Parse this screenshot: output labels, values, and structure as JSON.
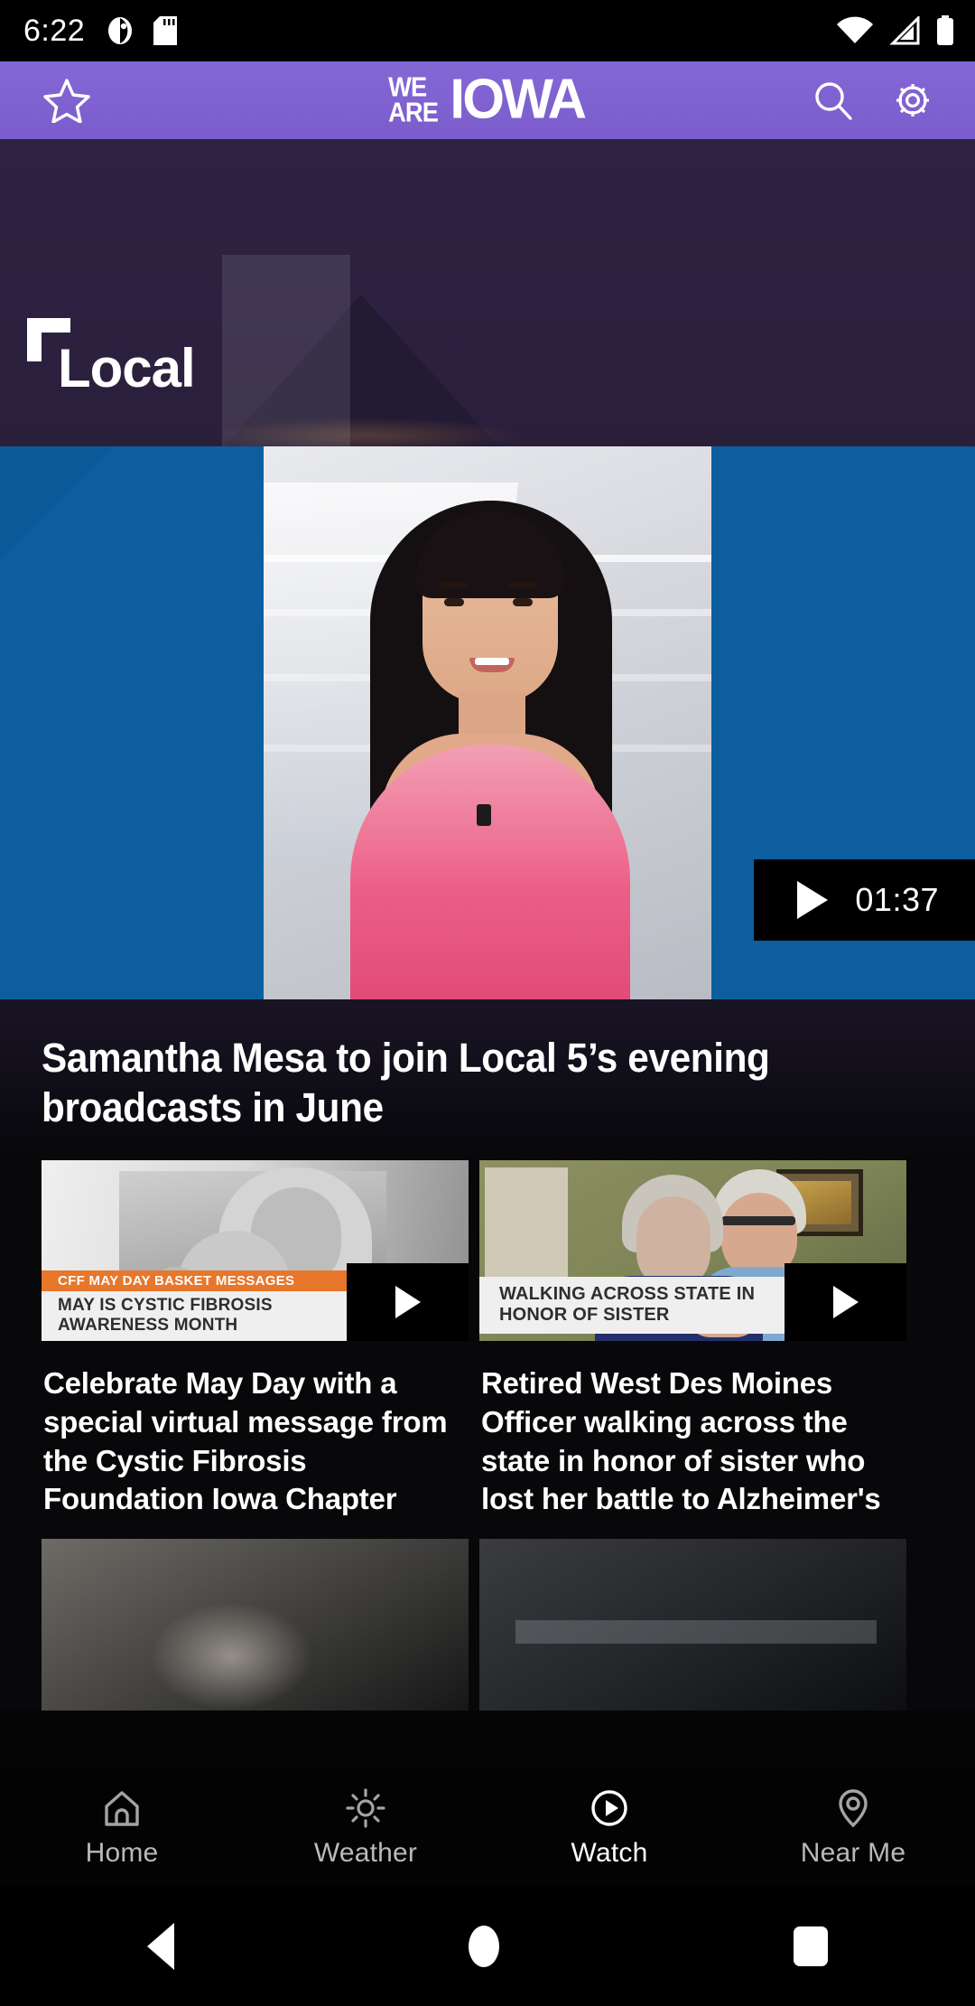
{
  "status_bar": {
    "time": "6:22",
    "icons_left": [
      "android-head-icon",
      "sd-card-icon"
    ],
    "icons_right": [
      "wifi-icon",
      "cellular-signal-icon",
      "battery-icon"
    ]
  },
  "app_bar": {
    "favorite_icon": "star-icon",
    "logo": {
      "line1": "WE",
      "line2": "ARE",
      "word": "IOWA"
    },
    "search_icon": "search-icon",
    "settings_icon": "gear-icon",
    "background_color": "#7f61d0"
  },
  "section": {
    "title": "Local",
    "background_color": "#2b2140"
  },
  "hero": {
    "headline": "Samantha Mesa to join Local 5’s evening broadcasts in June",
    "duration": "01:37",
    "play_icon": "play-icon",
    "image_alt_colors": {
      "pillar": "#0d5e9f"
    }
  },
  "cards": [
    {
      "title": "Celebrate May Day with a special virtual message from the Cystic Fibrosis Foundation Iowa Chapter",
      "play_icon": "play-icon",
      "lower_third_top": "CFF MAY DAY BASKET MESSAGES",
      "lower_third_bottom": "MAY IS CYSTIC FIBROSIS AWARENESS MONTH",
      "banner_color": "#e8762b"
    },
    {
      "title": "Retired West Des Moines Officer walking across the state in honor of sister who lost her battle to Alzheimer's",
      "play_icon": "play-icon",
      "lower_third_bottom": "WALKING ACROSS STATE IN HONOR OF SISTER"
    }
  ],
  "tab_bar": {
    "items": [
      {
        "label": "Home",
        "icon": "home-icon",
        "active": false
      },
      {
        "label": "Weather",
        "icon": "sun-icon",
        "active": false
      },
      {
        "label": "Watch",
        "icon": "play-circle-icon",
        "active": true
      },
      {
        "label": "Near Me",
        "icon": "map-pin-icon",
        "active": false
      }
    ]
  },
  "system_nav": {
    "back": "back-triangle-icon",
    "home": "home-circle-icon",
    "recents": "recents-square-icon"
  }
}
